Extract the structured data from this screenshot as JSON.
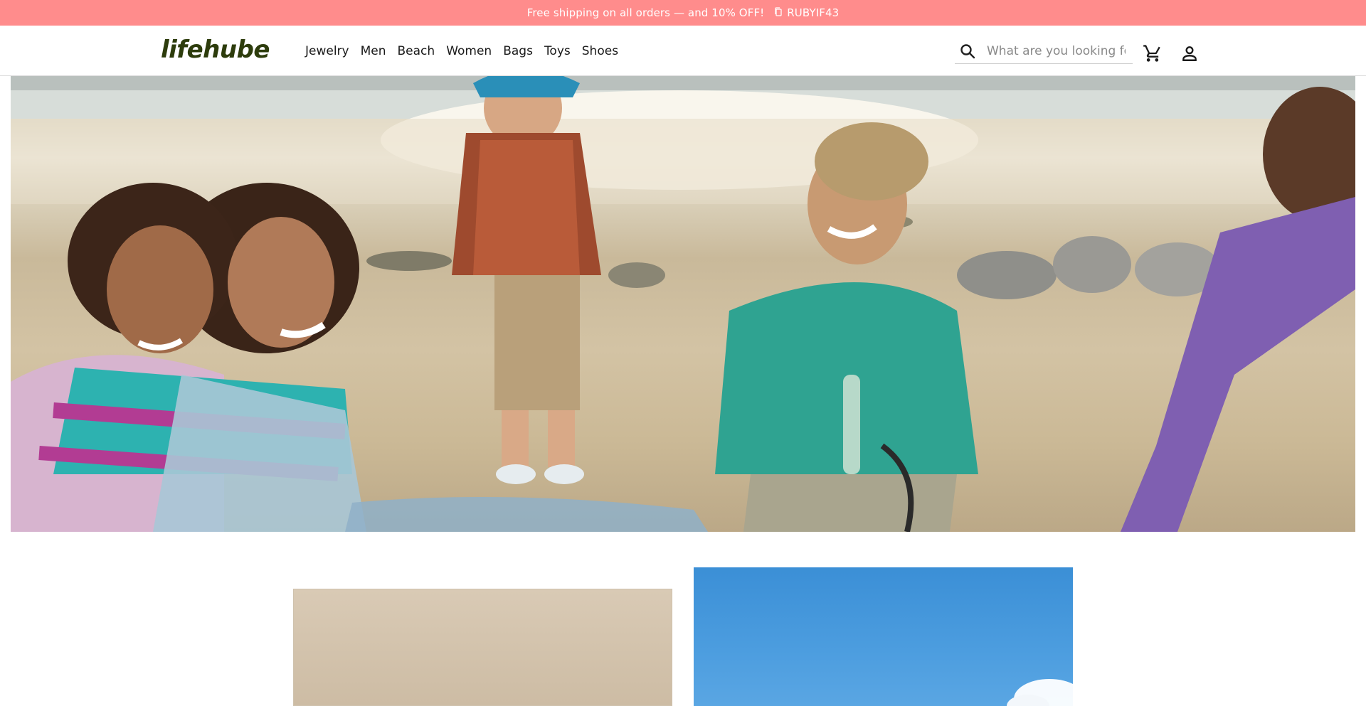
{
  "announcement": {
    "text": "Free shipping on all orders — and 10% OFF!",
    "coupon_code": "RUBYIF43",
    "icon": "copy-icon"
  },
  "header": {
    "logo": "lifehube",
    "nav": [
      {
        "label": "Jewelry"
      },
      {
        "label": "Men"
      },
      {
        "label": "Beach"
      },
      {
        "label": "Women"
      },
      {
        "label": "Bags"
      },
      {
        "label": "Toys"
      },
      {
        "label": "Shoes"
      }
    ],
    "search": {
      "placeholder": "What are you looking for?",
      "icon": "search-icon"
    },
    "cart_icon": "cart-icon",
    "account_icon": "account-icon"
  },
  "colors": {
    "announcement_bg": "#ff8c8c",
    "logo": "#2d3c0c",
    "sky_blue": "#4c9ddf"
  }
}
